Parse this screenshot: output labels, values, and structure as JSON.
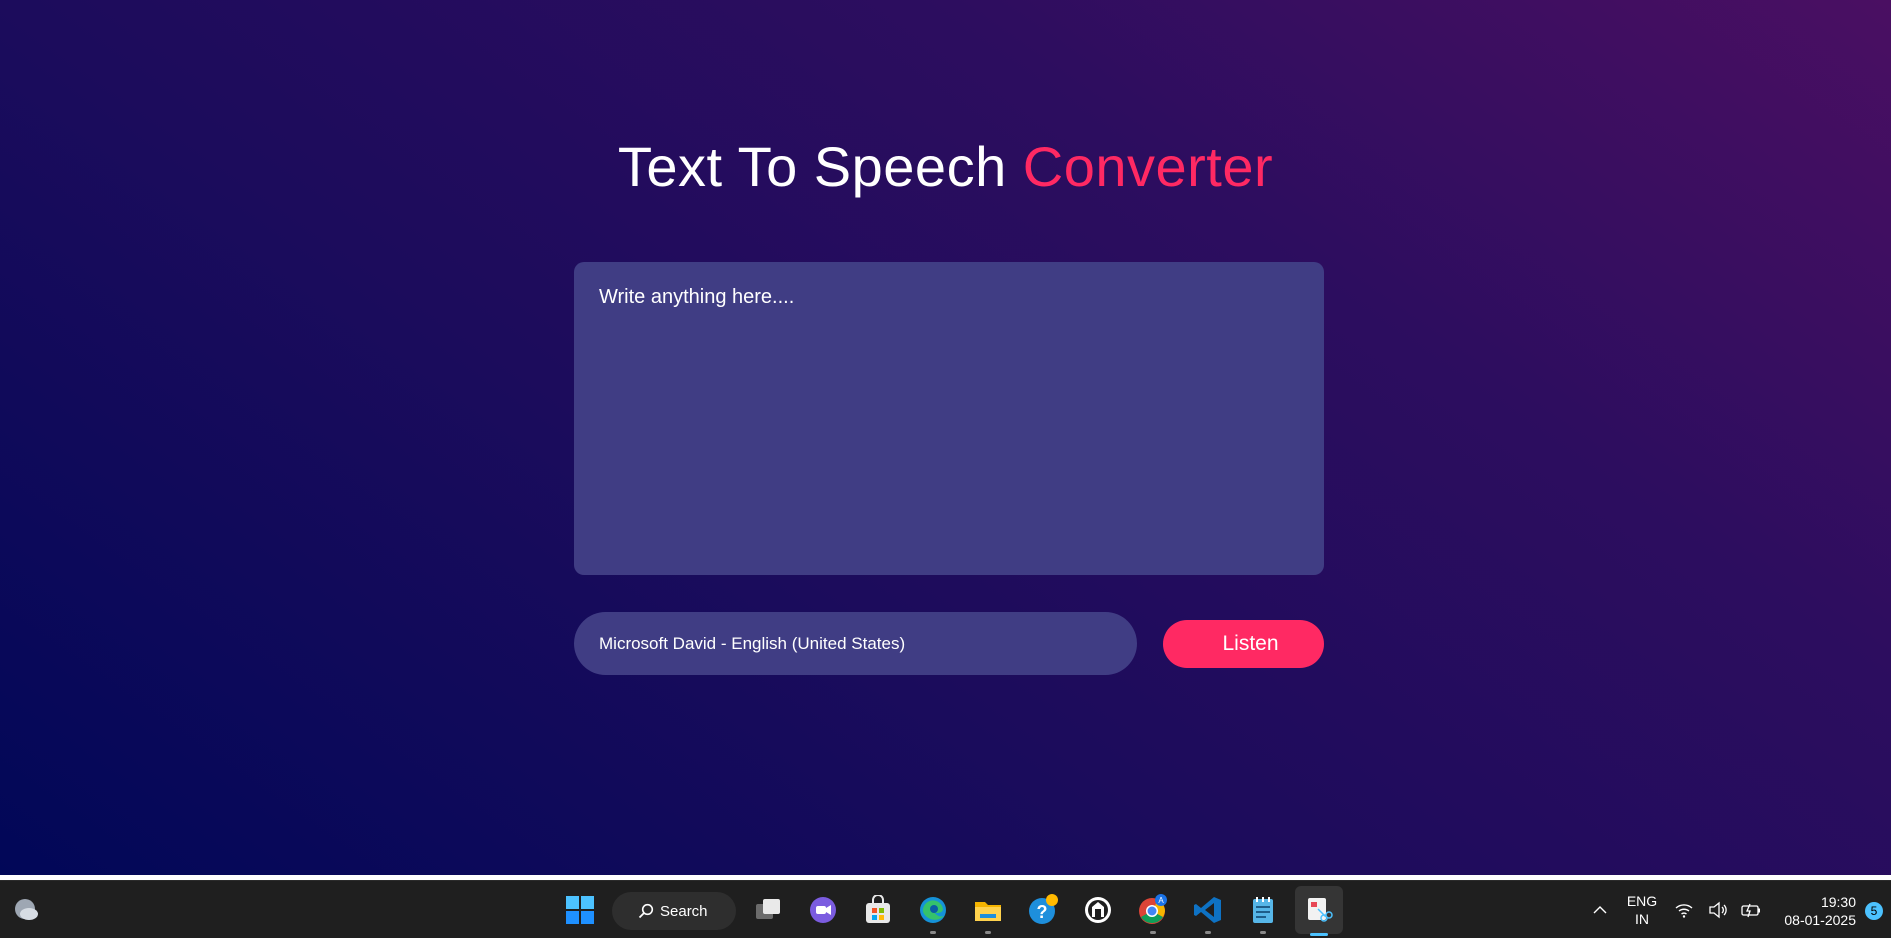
{
  "app": {
    "title_part1": "Text To Speech",
    "title_part2": "Converter",
    "textarea_placeholder": "Write anything here....",
    "voice_selected": "Microsoft David - English (United States)",
    "listen_label": "Listen"
  },
  "colors": {
    "accent": "#ff2963",
    "panel": "#403d84"
  },
  "taskbar": {
    "search_label": "Search",
    "apps": [
      "widgets-icon",
      "windows-start-icon",
      "task-view-icon",
      "meet-icon",
      "store-icon",
      "edge-icon",
      "file-explorer-icon",
      "help-icon",
      "app-icon",
      "chrome-icon",
      "vscode-icon",
      "notepad-icon",
      "snipping-tool-icon"
    ],
    "language_line1": "ENG",
    "language_line2": "IN",
    "time": "19:30",
    "date": "08-01-2025",
    "notification_count": "5"
  }
}
